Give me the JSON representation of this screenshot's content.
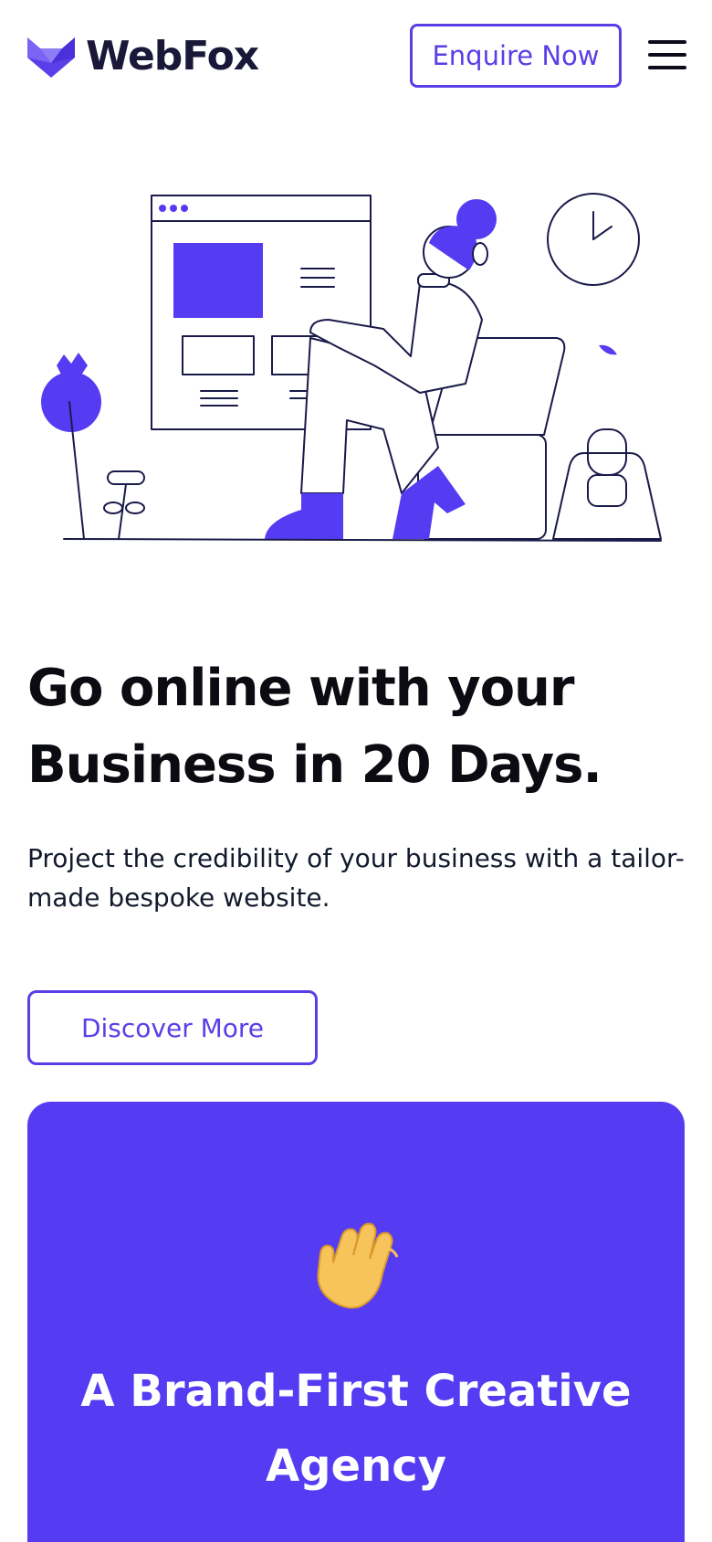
{
  "header": {
    "brand": "WebFox",
    "enquire_label": "Enquire Now"
  },
  "hero": {
    "title_line1": "Go online with your",
    "title_line2": "Business in 20 Days.",
    "subtitle": "Project the credibility of your business with a tailor-made bespoke website.",
    "cta_label": "Discover More"
  },
  "brand_card": {
    "icon": "waving-hand-icon",
    "title_line1": "A Brand-First Creative",
    "title_line2": "Agency"
  },
  "colors": {
    "accent": "#553cf2",
    "text": "#0b0b12",
    "background": "#ffffff"
  }
}
